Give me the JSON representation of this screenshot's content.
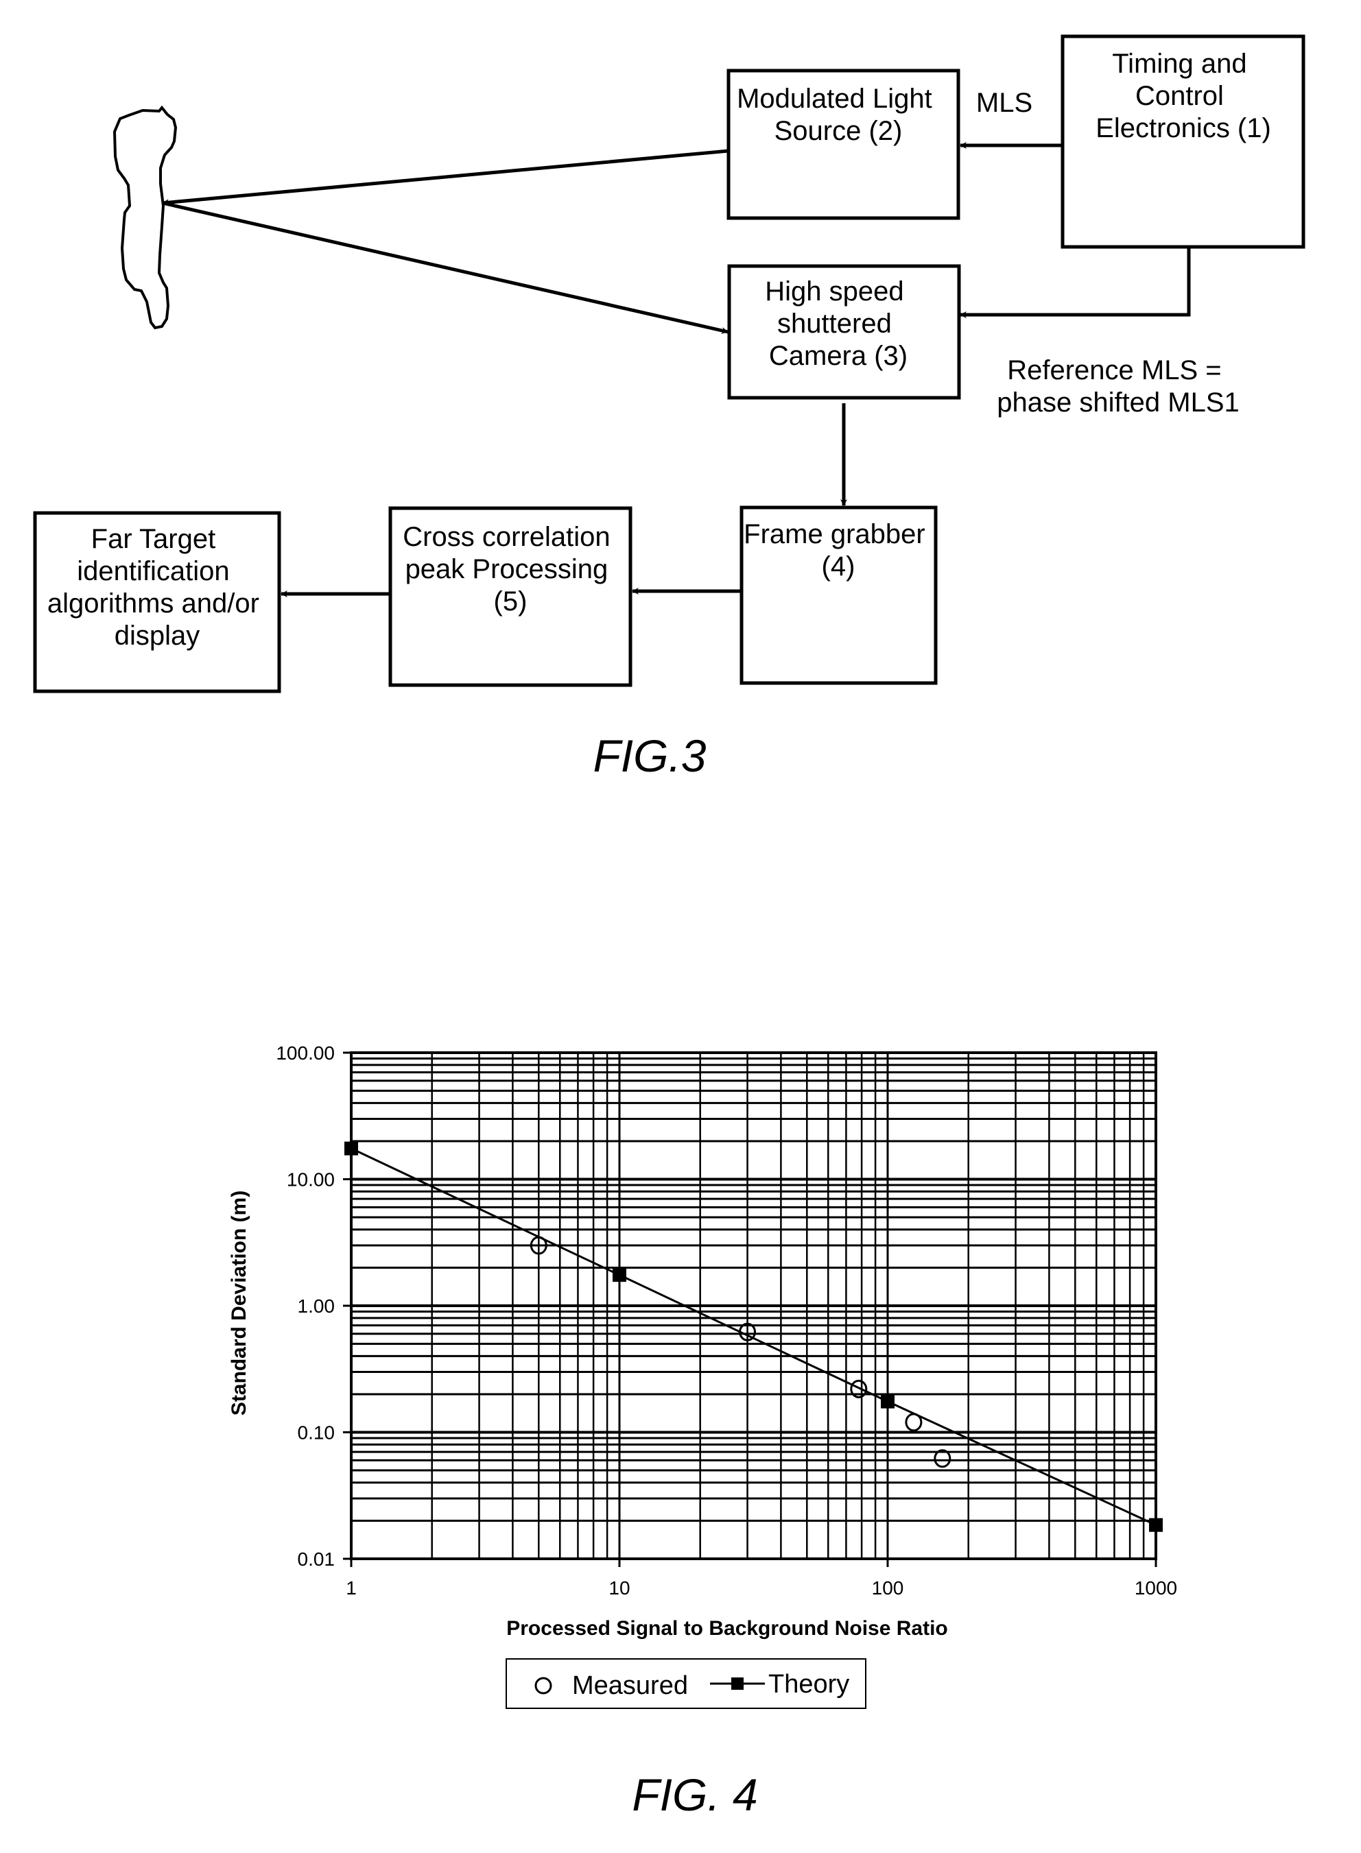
{
  "fig3": {
    "caption": "FIG.3",
    "boxes": {
      "timing": [
        "Timing and",
        "Control",
        "Electronics (1)"
      ],
      "light_source": [
        "Modulated Light",
        "Source (2)"
      ],
      "camera": [
        "High speed",
        "shuttered",
        "Camera (3)"
      ],
      "frame_grabber": [
        "Frame grabber",
        "(4)"
      ],
      "cross_correlation": [
        "Cross correlation",
        "peak Processing",
        "(5)"
      ],
      "far_target": [
        "Far Target",
        "identification",
        "algorithms and/or",
        "display"
      ]
    },
    "labels": {
      "mls": "MLS",
      "reference": [
        "Reference MLS =",
        "phase shifted MLS1"
      ]
    }
  },
  "fig4": {
    "caption": "FIG. 4"
  },
  "chart_data": {
    "type": "scatter",
    "title": "",
    "xlabel": "Processed Signal to Background Noise Ratio",
    "ylabel": "Standard Deviation (m)",
    "xscale": "log",
    "yscale": "log",
    "xlim": [
      1,
      1000
    ],
    "ylim": [
      0.01,
      100
    ],
    "xticks": [
      {
        "value": 1,
        "label": "1"
      },
      {
        "value": 10,
        "label": "10"
      },
      {
        "value": 100,
        "label": "100"
      },
      {
        "value": 1000,
        "label": "1000"
      }
    ],
    "yticks": [
      {
        "value": 100,
        "label": "100.00"
      },
      {
        "value": 10,
        "label": "10.00"
      },
      {
        "value": 1,
        "label": "1.00"
      },
      {
        "value": 0.1,
        "label": "0.10"
      },
      {
        "value": 0.01,
        "label": "0.01"
      }
    ],
    "grid": true,
    "legend_position": "bottom-center",
    "series": [
      {
        "name": "Measured",
        "marker": "open-circle",
        "line": false,
        "x": [
          5,
          30,
          78,
          125,
          160
        ],
        "y": [
          3.0,
          0.62,
          0.22,
          0.12,
          0.062
        ]
      },
      {
        "name": "Theory",
        "marker": "filled-square",
        "line": true,
        "x": [
          1,
          10,
          100,
          1000
        ],
        "y": [
          17.5,
          1.75,
          0.175,
          0.0185
        ]
      }
    ]
  }
}
